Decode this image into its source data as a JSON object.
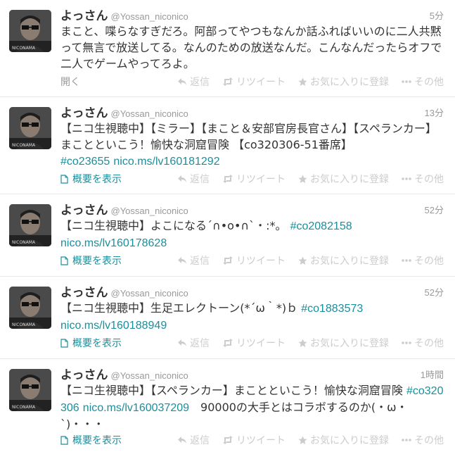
{
  "actions": {
    "reply": "返信",
    "retweet": "リツイート",
    "favorite": "お気に入りに登録",
    "more": "その他"
  },
  "colors": {
    "link": "#1a8f9c",
    "muted": "#999999",
    "action": "#cccccc"
  },
  "tweets": [
    {
      "name": "よっさん",
      "handle": "@Yossan_niconico",
      "time": "5分",
      "text": "まこと、喋らなすぎだろ。阿部ってやつもなんか話ふればいいのに二人共黙って無言で放送してる。なんのための放送なんだ。こんなんだったらオフで二人でゲームやってろよ。",
      "footer": "開く"
    },
    {
      "name": "よっさん",
      "handle": "@Yossan_niconico",
      "time": "13分",
      "text": "【ニコ生視聴中】【ミラー】【まこと＆安部官房長官さん】【スペランカー】まことといこう！愉快な洞窟冒険 【co320306-51番席】",
      "link1": "#co23655",
      "link2": "nico.ms/lv160181292",
      "footer": "概要を表示"
    },
    {
      "name": "よっさん",
      "handle": "@Yossan_niconico",
      "time": "52分",
      "text": "【ニコ生視聴中】よこになる´∩•ο•∩`・:*。",
      "link1": "#co2082158",
      "link2": "nico.ms/lv160178628",
      "footer": "概要を表示"
    },
    {
      "name": "よっさん",
      "handle": "@Yossan_niconico",
      "time": "52分",
      "text": "【ニコ生視聴中】生足エレクトーン(*´ω｀*)ｂ",
      "link1": "#co1883573",
      "link2": "nico.ms/lv160188949",
      "footer": "概要を表示"
    },
    {
      "name": "よっさん",
      "handle": "@Yossan_niconico",
      "time": "1時間",
      "text_a": "【ニコ生視聴中】【スペランカー】まことといこう！愉快な洞窟冒険",
      "link1": "#co320306",
      "link2": "nico.ms/lv160037209",
      "text_b": "90000の大手とはコラボするのか(・ω・`)・・・",
      "footer": "概要を表示"
    }
  ]
}
